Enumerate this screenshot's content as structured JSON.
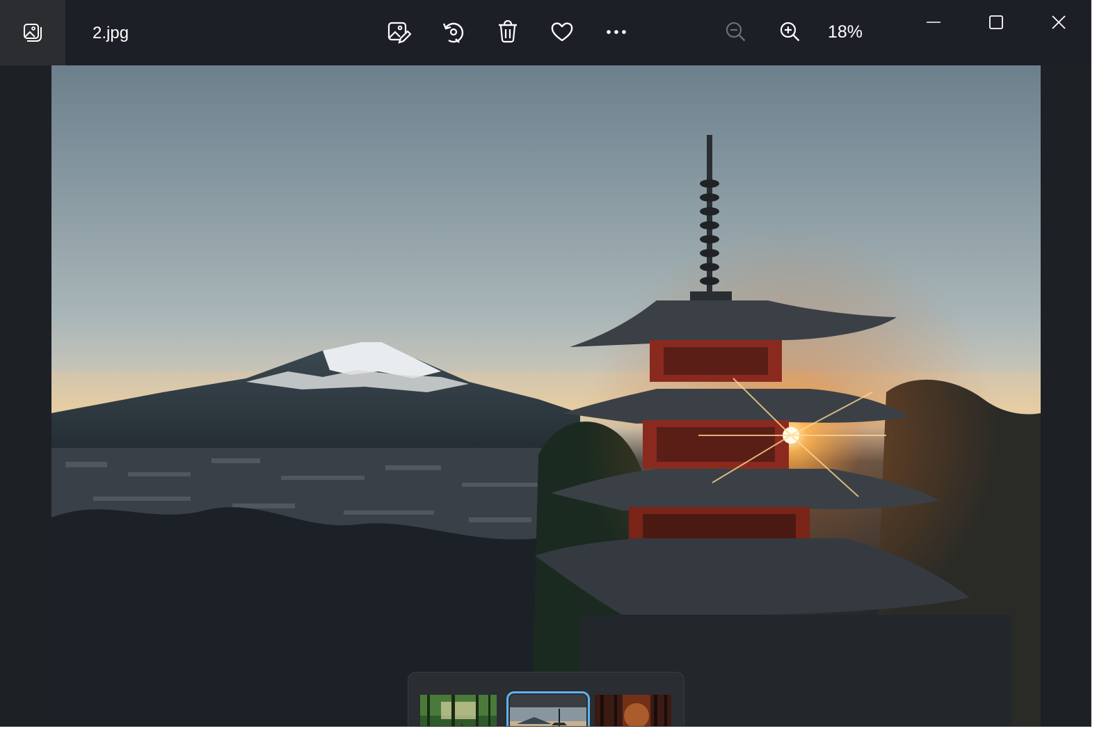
{
  "window": {
    "filename": "2.jpg",
    "zoom": "18%"
  },
  "toolbar": {
    "buttons": [
      {
        "name": "edit-image-button",
        "icon": "edit-image-icon"
      },
      {
        "name": "rotate-button",
        "icon": "rotate-icon"
      },
      {
        "name": "delete-button",
        "icon": "trash-icon"
      },
      {
        "name": "favorite-button",
        "icon": "heart-icon"
      },
      {
        "name": "more-button",
        "icon": "more-icon"
      }
    ],
    "zoom_out_enabled": false
  },
  "filmstrip": {
    "selected_index": 1,
    "thumbnails": [
      {
        "name": "thumbnail-forest-sun",
        "colors": [
          "#2f5a2a",
          "#8a7a4a",
          "#d8c88a"
        ]
      },
      {
        "name": "thumbnail-pagoda-fuji",
        "colors": [
          "#4a5a66",
          "#2a3036",
          "#e0a050"
        ]
      },
      {
        "name": "thumbnail-autumn-forest",
        "colors": [
          "#3a1a12",
          "#8a3a1a",
          "#d07a3a"
        ]
      }
    ]
  },
  "colors": {
    "accent": "#5cb3f0",
    "titlebar": "#1c1f26"
  }
}
